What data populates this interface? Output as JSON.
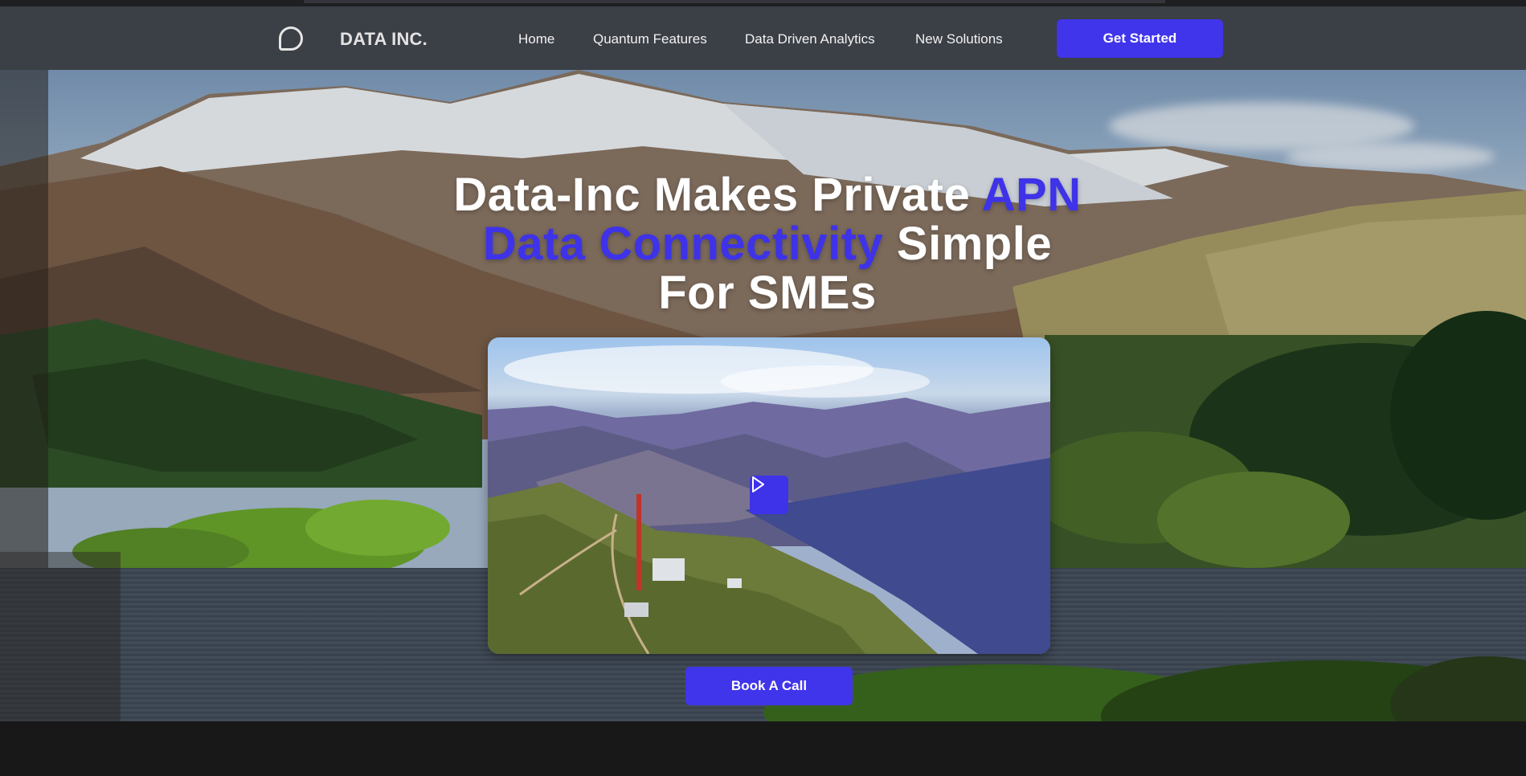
{
  "brand": {
    "name": "DATA INC.",
    "logo_icon": "rounded-square-logo-icon"
  },
  "nav": {
    "links": [
      "Home",
      "Quantum Features",
      "Data Driven Analytics",
      "New Solutions"
    ],
    "cta_label": "Get Started"
  },
  "hero": {
    "headline_part1": "Data-Inc Makes Private ",
    "headline_accent1": "APN",
    "headline_accent2": "Data Connectivity",
    "headline_part2": " Simple",
    "headline_part3": "For SMEs",
    "video_play_icon": "play-icon",
    "cta_label": "Book A Call"
  },
  "colors": {
    "accent": "#4035ea",
    "navbar_bg": "#3b3f46",
    "page_bg": "#181818",
    "heading_text": "#ffffff"
  }
}
